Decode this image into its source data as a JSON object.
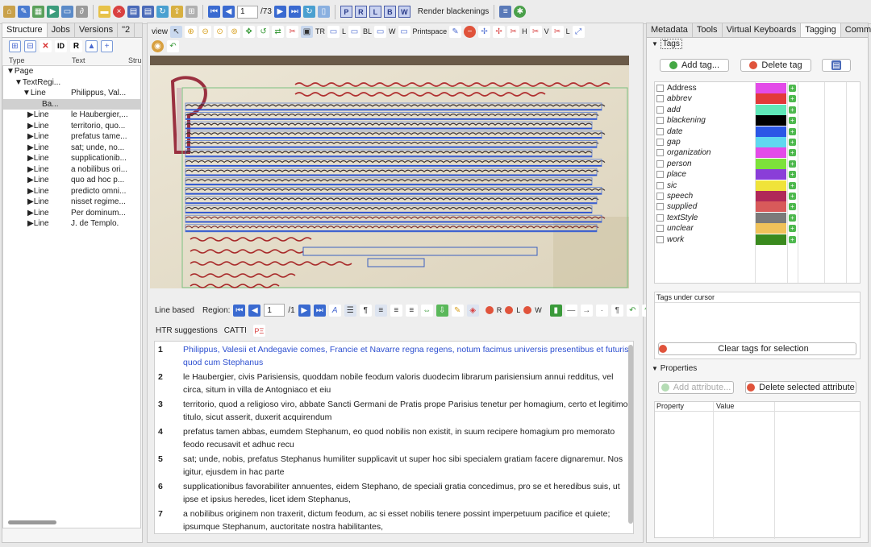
{
  "toolbar": {
    "page_value": "1",
    "page_total": "/73",
    "region_letters": [
      "P",
      "R",
      "L",
      "B",
      "W"
    ],
    "render_label": "Render blackenings"
  },
  "left": {
    "tabs": [
      "Structure",
      "Jobs",
      "Versions",
      "\"2"
    ],
    "columns": [
      "Type",
      "Text",
      "Stru"
    ],
    "tree": [
      {
        "label": "▼Page",
        "text": ""
      },
      {
        "label": "▼TextRegi...",
        "text": ""
      },
      {
        "label": "▼Line",
        "text": "Philippus, Val..."
      },
      {
        "label": "Ba...",
        "text": ""
      },
      {
        "label": "▶Line",
        "text": "le Haubergier,..."
      },
      {
        "label": "▶Line",
        "text": "territorio, quo..."
      },
      {
        "label": "▶Line",
        "text": "prefatus tame..."
      },
      {
        "label": "▶Line",
        "text": "sat; unde, no..."
      },
      {
        "label": "▶Line",
        "text": "supplicationib..."
      },
      {
        "label": "▶Line",
        "text": "a nobilibus ori..."
      },
      {
        "label": "▶Line",
        "text": "quo ad hoc p..."
      },
      {
        "label": "▶Line",
        "text": "predicto omni..."
      },
      {
        "label": "▶Line",
        "text": "nisset regime..."
      },
      {
        "label": "▶Line",
        "text": "Per dominum..."
      },
      {
        "label": "▶Line",
        "text": "J. de Templo."
      }
    ]
  },
  "canvas_toolbar": {
    "view_label": "view",
    "tr": "TR",
    "l": "L",
    "bl": "BL",
    "w": "W",
    "printspace": "Printspace",
    "h": "H",
    "v": "V",
    "l2": "L"
  },
  "editor": {
    "mode": "Line based",
    "region_label": "Region:",
    "region_value": "1",
    "region_total": "/1",
    "r": "R",
    "l": "L",
    "w": "W",
    "htr": "HTR suggestions",
    "catti": "CATTI"
  },
  "transcript": [
    {
      "no": "1",
      "text": "Philippus, Valesii et Andegavie comes, Francie et Navarre regna regens, notum facimus universis presentibus et futuris quod cum Stephanus"
    },
    {
      "no": "2",
      "text": "le Haubergier, civis Parisiensis, quoddam nobile feodum valoris duodecim librarum parisiensium annui redditus, vel circa, situm in villa de Antogniaco et eiu"
    },
    {
      "no": "3",
      "text": "territorio, quod a  religioso viro, abbate Sancti Germani de Pratis prope Parisius tenetur per homagium, certo et legitimo titulo, sicut asserit, duxerit acquirendum"
    },
    {
      "no": "4",
      "text": "prefatus tamen abbas, eumdem Stephanum, eo quod nobilis non existit, in suum recipere homagium pro memorato feodo recusavit et adhuc recu"
    },
    {
      "no": "5",
      "text": "sat; unde, nobis, prefatus Stephanus humiliter supplicavit ut super hoc sibi specialem gratiam facere dignaremur. Nos igitur,  ejusdem in hac parte"
    },
    {
      "no": "6",
      "text": "supplicationibus favorabiliter annuentes, eidem Stephano, de speciali gratia concedimus, pro se et heredibus suis, ut ipse et ipsius heredes, licet idem Stephanus,"
    },
    {
      "no": "7",
      "text": "a nobilibus originem non traxerit, dictum feodum, ac si esset nobilis tenere possint imperpetuum pacifice et quiete; ipsumque Stephanum, auctoritate nostra habilitantes,"
    }
  ],
  "right": {
    "tabs": [
      "Metadata",
      "Tools",
      "Virtual Keyboards",
      "Tagging",
      "Comments"
    ],
    "tags_section": "Tags",
    "add_tag": "Add tag...",
    "delete_tag": "Delete tag",
    "tags": [
      {
        "name": "Address",
        "color": "#e34be8",
        "italic": false
      },
      {
        "name": "abbrev",
        "color": "#e23a3a"
      },
      {
        "name": "add",
        "color": "#5fe8b8"
      },
      {
        "name": "blackening",
        "color": "#000000"
      },
      {
        "name": "date",
        "color": "#2b57e6"
      },
      {
        "name": "gap",
        "color": "#5fd8f0"
      },
      {
        "name": "organization",
        "color": "#e34be8"
      },
      {
        "name": "person",
        "color": "#7de23a"
      },
      {
        "name": "place",
        "color": "#8a3ed8"
      },
      {
        "name": "sic",
        "color": "#f0e33a"
      },
      {
        "name": "speech",
        "color": "#b02858"
      },
      {
        "name": "supplied",
        "color": "#d85a5a"
      },
      {
        "name": "textStyle",
        "color": "#7a7a7a"
      },
      {
        "name": "unclear",
        "color": "#f0c25a"
      },
      {
        "name": "work",
        "color": "#3a8a1e"
      }
    ],
    "tags_under_cursor": "Tags under cursor",
    "clear_tags": "Clear tags for selection",
    "properties_section": "Properties",
    "add_attribute": "Add attribute...",
    "delete_attribute": "Delete selected attribute",
    "prop_cols": [
      "Property",
      "Value"
    ]
  },
  "colors": {
    "highlight_text": "#2d4fd0",
    "canvas_bg": "#f2efe6"
  }
}
